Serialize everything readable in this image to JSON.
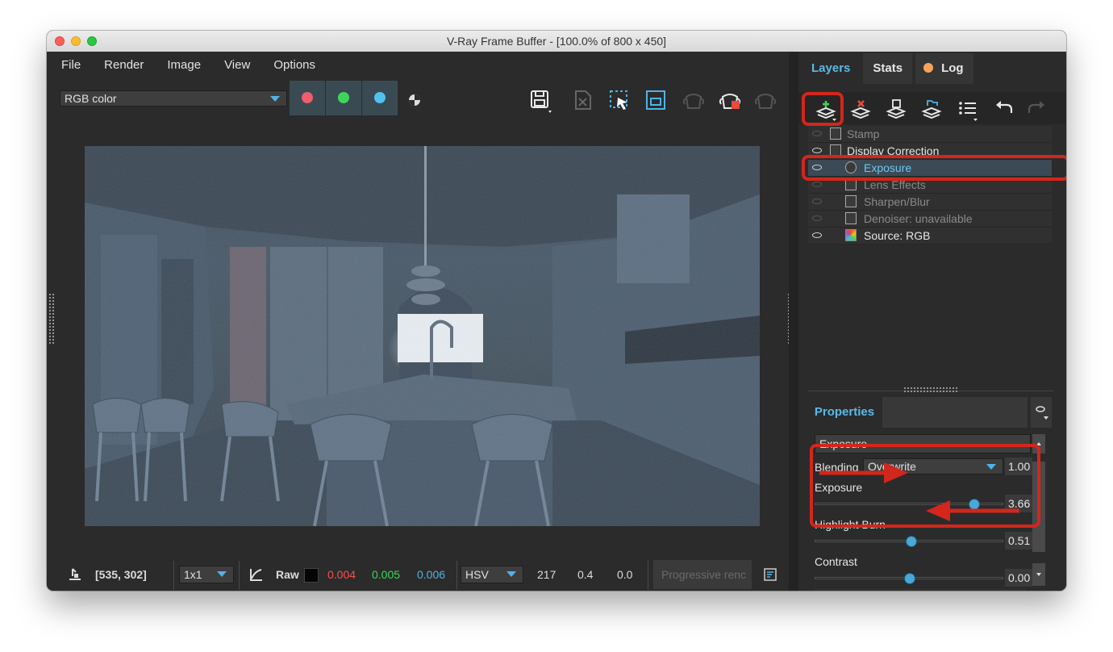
{
  "window": {
    "title": "V-Ray Frame Buffer - [100.0% of 800 x 450]"
  },
  "colors": {
    "accent": "#4fb3e6",
    "highlight_red": "#d3261c",
    "red_value": "#ff4d4d",
    "green_value": "#3ed65a",
    "blue_value": "#4fb3e6"
  },
  "menu": {
    "file": "File",
    "render": "Render",
    "image": "Image",
    "view": "View",
    "options": "Options"
  },
  "toolbar": {
    "channel_select": "RGB color",
    "channel_buttons": [
      "red-channel",
      "green-channel",
      "blue-channel",
      "alpha-channel"
    ],
    "icons": [
      "save-icon",
      "clear-image-icon",
      "region-render-icon",
      "display-region-icon",
      "stop-render-icon",
      "render-icon",
      "render-interactive-icon"
    ]
  },
  "statusbar": {
    "coords": "[535, 302]",
    "sample_size": "1x1",
    "raw_label": "Raw",
    "r": "0.004",
    "g": "0.005",
    "b": "0.006",
    "color_mode": "HSV",
    "h": "217",
    "s": "0.4",
    "v": "0.0",
    "progressive": "Progressive renc"
  },
  "panel": {
    "tabs": {
      "layers": "Layers",
      "stats": "Stats",
      "log": "Log"
    },
    "layers": [
      {
        "name": "Stamp",
        "state": "disabled"
      },
      {
        "name": "Display Correction",
        "state": "enabled"
      },
      {
        "name": "Exposure",
        "state": "selected"
      },
      {
        "name": "Lens Effects",
        "state": "disabled"
      },
      {
        "name": "Sharpen/Blur",
        "state": "disabled"
      },
      {
        "name": "Denoiser: unavailable",
        "state": "disabled"
      },
      {
        "name": "Source: RGB",
        "state": "enabled"
      }
    ]
  },
  "properties": {
    "tab": "Properties",
    "layer_select": "Exposure",
    "blending_label": "Blending",
    "blending_value": "Overwrite",
    "blending_amount": "1.00",
    "exposure_label": "Exposure",
    "exposure_value": "3.66",
    "exposure_level": 0.84,
    "highlight_label": "Highlight Burn",
    "highlight_value": "0.51",
    "highlight_level": 0.51,
    "contrast_label": "Contrast",
    "contrast_value": "0.00",
    "contrast_level": 0.5
  }
}
